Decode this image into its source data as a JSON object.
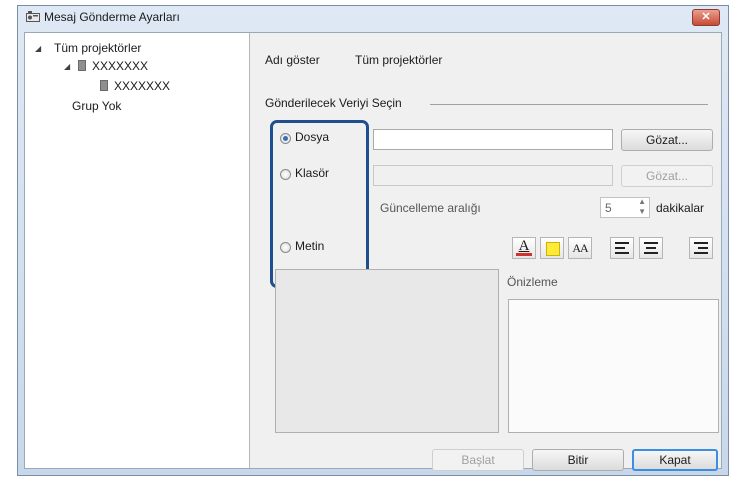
{
  "window": {
    "title": "Mesaj Gönderme Ayarları",
    "close_label": "✕"
  },
  "tree": {
    "root": "Tüm projektörler",
    "child": "XXXXXXX",
    "grandchild": "XXXXXXX",
    "no_group": "Grup Yok"
  },
  "header": {
    "name_label": "Adı göster",
    "name_value": "Tüm projektörler"
  },
  "section": {
    "title": "Gönderilecek Veriyi Seçin"
  },
  "options": {
    "file": {
      "label": "Dosya",
      "checked": true,
      "browse": "Gözat..."
    },
    "folder": {
      "label": "Klasör",
      "checked": false,
      "browse": "Gözat..."
    },
    "text": {
      "label": "Metin",
      "checked": false
    }
  },
  "interval": {
    "label": "Güncelleme aralığı",
    "value": "5",
    "unit": "dakikalar"
  },
  "toolbar": {
    "font_color": "A",
    "fill_color": "",
    "font_size": "AA"
  },
  "preview": {
    "label": "Önizleme"
  },
  "buttons": {
    "start": "Başlat",
    "finish": "Bitir",
    "close": "Kapat"
  },
  "colors": {
    "highlight": "#1f4f8e",
    "font_color_bar": "#d0332b",
    "fill_yellow": "#ffea3a"
  }
}
